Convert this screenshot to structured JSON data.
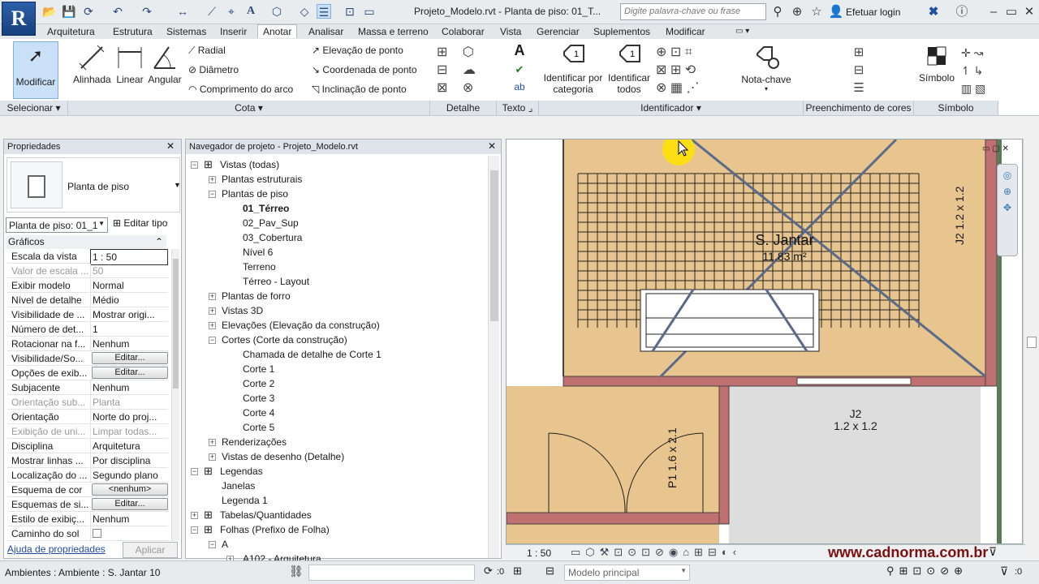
{
  "title_bar": {
    "app_letter": "R",
    "doc_title": "Projeto_Modelo.rvt - Planta de piso: 01_T...",
    "search_placeholder": "Digite palavra-chave ou frase",
    "login_label": "Efetuar login"
  },
  "tabs": [
    "Arquitetura",
    "Estrutura",
    "Sistemas",
    "Inserir",
    "Anotar",
    "Analisar",
    "Massa e terreno",
    "Colaborar",
    "Vista",
    "Gerenciar",
    "Suplementos",
    "Modificar"
  ],
  "active_tab": "Anotar",
  "ribbon": {
    "modificar": "Modificar",
    "selecionar": "Selecionar",
    "cota_panel": "Cota",
    "alinhada": "Alinhada",
    "linear": "Linear",
    "angular": "Angular",
    "radial": "Radial",
    "diametro": "Diâmetro",
    "comprimento_arco": "Comprimento do arco",
    "elevacao_ponto": "Elevação de ponto",
    "coordenada_ponto": "Coordenada de ponto",
    "inclinacao_ponto": "Inclinação de ponto",
    "detalhe_panel": "Detalhe",
    "texto_panel": "Texto",
    "texto_icon": "A",
    "identificar_categoria": "Identificar por categoria",
    "identificar_todos": "Identificar todos",
    "identificador_panel": "Identificador",
    "nota_chave": "Nota-chave",
    "preenchimento_panel": "Preenchimento de cores",
    "simbolo": "Símbolo",
    "simbolo_panel": "Símbolo"
  },
  "properties": {
    "header": "Propriedades",
    "type_name": "Planta de piso",
    "selector": "Planta de piso: 01_1",
    "edit_type": "Editar tipo",
    "section": "Gráficos",
    "rows": [
      {
        "k": "Escala da vista",
        "v": "1 : 50",
        "dis": false,
        "input": true
      },
      {
        "k": "Valor de escala ...",
        "v": "50",
        "dis": true
      },
      {
        "k": "Exibir modelo",
        "v": "Normal",
        "dis": false
      },
      {
        "k": "Nível de detalhe",
        "v": "Médio",
        "dis": false
      },
      {
        "k": "Visibilidade de ...",
        "v": "Mostrar origi...",
        "dis": false
      },
      {
        "k": "Número de det...",
        "v": "1",
        "dis": false
      },
      {
        "k": "Rotacionar na f...",
        "v": "Nenhum",
        "dis": false
      },
      {
        "k": "Visibilidade/So...",
        "v": "Editar...",
        "dis": false,
        "btn": true
      },
      {
        "k": "Opções de exib...",
        "v": "Editar...",
        "dis": false,
        "btn": true
      },
      {
        "k": "Subjacente",
        "v": "Nenhum",
        "dis": false
      },
      {
        "k": "Orientação sub...",
        "v": "Planta",
        "dis": true
      },
      {
        "k": "Orientação",
        "v": "Norte do proj...",
        "dis": false
      },
      {
        "k": "Exibição de uni...",
        "v": "Limpar todas...",
        "dis": true
      },
      {
        "k": "Disciplina",
        "v": "Arquitetura",
        "dis": false
      },
      {
        "k": "Mostrar linhas ...",
        "v": "Por disciplina",
        "dis": false
      },
      {
        "k": "Localização do ...",
        "v": "Segundo plano",
        "dis": false
      },
      {
        "k": "Esquema de cor",
        "v": "<nenhum>",
        "dis": false,
        "btn": true
      },
      {
        "k": "Esquemas de si...",
        "v": "Editar...",
        "dis": false,
        "btn": true
      },
      {
        "k": "Estilo de exibiç...",
        "v": "Nenhum",
        "dis": false
      },
      {
        "k": "Caminho do sol",
        "v": "",
        "dis": false,
        "check": true
      }
    ],
    "help_link": "Ajuda de propriedades",
    "apply": "Aplicar"
  },
  "browser": {
    "header": "Navegador de projeto - Projeto_Modelo.rvt",
    "items": [
      {
        "t": "Vistas (todas)",
        "lvl": 0,
        "tog": "-",
        "icon": true
      },
      {
        "t": "Plantas estruturais",
        "lvl": 1,
        "tog": "+"
      },
      {
        "t": "Plantas de piso",
        "lvl": 1,
        "tog": "-"
      },
      {
        "t": "01_Térreo",
        "lvl": 2,
        "bold": true
      },
      {
        "t": "02_Pav_Sup",
        "lvl": 2
      },
      {
        "t": "03_Cobertura",
        "lvl": 2
      },
      {
        "t": "Nível 6",
        "lvl": 2
      },
      {
        "t": "Terreno",
        "lvl": 2
      },
      {
        "t": "Térreo - Layout",
        "lvl": 2
      },
      {
        "t": "Plantas de forro",
        "lvl": 1,
        "tog": "+"
      },
      {
        "t": "Vistas 3D",
        "lvl": 1,
        "tog": "+"
      },
      {
        "t": "Elevações (Elevação da construção)",
        "lvl": 1,
        "tog": "+"
      },
      {
        "t": "Cortes (Corte da construção)",
        "lvl": 1,
        "tog": "-"
      },
      {
        "t": "Chamada de detalhe de Corte 1",
        "lvl": 2
      },
      {
        "t": "Corte 1",
        "lvl": 2
      },
      {
        "t": "Corte 2",
        "lvl": 2
      },
      {
        "t": "Corte 3",
        "lvl": 2
      },
      {
        "t": "Corte 4",
        "lvl": 2
      },
      {
        "t": "Corte 5",
        "lvl": 2
      },
      {
        "t": "Renderizações",
        "lvl": 1,
        "tog": "+"
      },
      {
        "t": "Vistas de desenho (Detalhe)",
        "lvl": 1,
        "tog": "+"
      },
      {
        "t": "Legendas",
        "lvl": 0,
        "tog": "-",
        "icon": true
      },
      {
        "t": "Janelas",
        "lvl": 1
      },
      {
        "t": "Legenda 1",
        "lvl": 1
      },
      {
        "t": "Tabelas/Quantidades",
        "lvl": 0,
        "tog": "+",
        "icon": true
      },
      {
        "t": "Folhas (Prefixo de Folha)",
        "lvl": 0,
        "tog": "-",
        "icon": true
      },
      {
        "t": "A",
        "lvl": 1,
        "tog": "-"
      },
      {
        "t": "A102 - Arquitetura",
        "lvl": 2,
        "tog": "+"
      }
    ]
  },
  "drawing": {
    "room_name": "S. Jantar",
    "room_area": "11.83 m²",
    "tag_j2_label": "J2",
    "tag_j2_size": "1.2 x 1.2",
    "tag_p1_label": "P1",
    "tag_p1_size": "1.6 x 2.1",
    "colors": {
      "floor": "#e8c48e",
      "wall": "#c07070",
      "grid": "#222222",
      "line": "#5a6a8a",
      "cursor": "#ffe300"
    }
  },
  "view_bar": {
    "scale": "1 : 50"
  },
  "watermark": "www.cadnorma.com.br",
  "status_bar": {
    "text": "Ambientes : Ambiente : S. Jantar 10",
    "workset_value": ":0",
    "model": "Modelo principal",
    "filter_value": ":0"
  }
}
